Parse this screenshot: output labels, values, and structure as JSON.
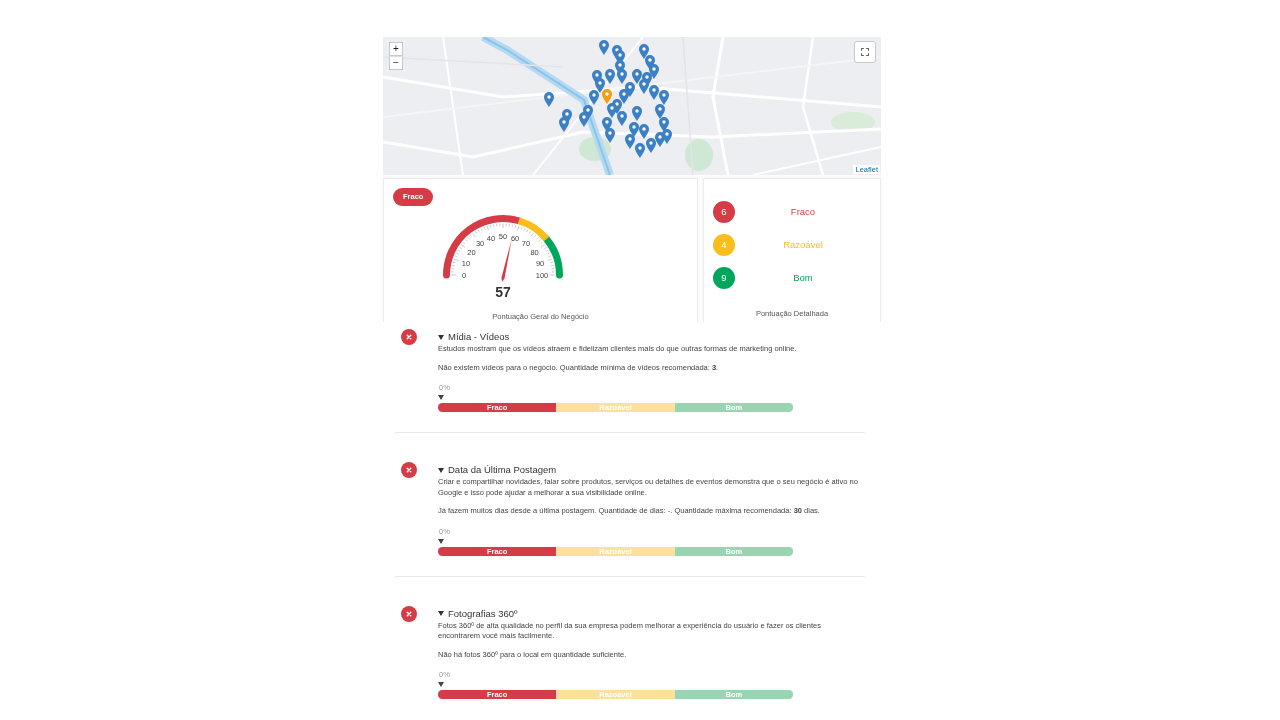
{
  "map": {
    "zoom_in": "+",
    "zoom_out": "−",
    "attribution": "Leaflet"
  },
  "overall": {
    "badge": "Fraco",
    "gauge": {
      "level": 0.57,
      "reading": "57",
      "tick_labels": [
        "0",
        "10",
        "20",
        "30",
        "40",
        "50",
        "60",
        "70",
        "80",
        "90",
        "100"
      ]
    },
    "caption": "Pontuação Geral do Negócio"
  },
  "summary": {
    "items": [
      {
        "count": "6",
        "label": "Fraco",
        "color": "#d63c45"
      },
      {
        "count": "4",
        "label": "Razoável",
        "color": "#fbbd1a"
      },
      {
        "count": "9",
        "label": "Bom",
        "color": "#00a65a"
      }
    ],
    "caption": "Pontuação Detalhada"
  },
  "checks": [
    {
      "title": "Mídia - Vídeos",
      "passed": false,
      "expanded": true,
      "paragraphs": [
        "Estudos mostram que os vídeos atraem e fidelizam clientes mais do que outras formas de marketing online.",
        "Não existem vídeos para o negócio. Quantidade mínima de vídeos recomendada: **3**."
      ],
      "reading": "0%",
      "level": 0,
      "scale": [
        {
          "label": "Fraco",
          "color": "#d63c45"
        },
        {
          "label": "Razoável",
          "color": "#fde09a"
        },
        {
          "label": "Bom",
          "color": "#98d6b3"
        }
      ]
    },
    {
      "title": "Data da Última Postagem",
      "passed": false,
      "expanded": true,
      "paragraphs": [
        "Criar e compartilhar novidades, falar sobre produtos, serviços ou detalhes de eventos demonstra que o seu negócio é ativo no Google e isso pode ajudar a melhorar a sua visibilidade online.",
        "Já fazem muitos dias desde a última postagem. Quantidade de dias: -. Quantidade máxima recomendada: **30** dias."
      ],
      "reading": "0%",
      "level": 0,
      "scale": [
        {
          "label": "Fraco",
          "color": "#d63c45"
        },
        {
          "label": "Razoável",
          "color": "#fde09a"
        },
        {
          "label": "Bom",
          "color": "#98d6b3"
        }
      ]
    },
    {
      "title": "Fotografias 360º",
      "passed": false,
      "expanded": true,
      "paragraphs": [
        "Fotos 360º de alta qualidade no perfil da sua empresa podem melhorar a experiência do usuário e fazer os clientes encontrarem você mais facilmente.",
        "Não há fotos 360º para o local em quantidade suficiente."
      ],
      "reading": "0%",
      "level": 0,
      "scale": [
        {
          "label": "Fraco",
          "color": "#d63c45"
        },
        {
          "label": "Razoável",
          "color": "#fde09a"
        },
        {
          "label": "Bom",
          "color": "#98d6b3"
        }
      ]
    }
  ]
}
